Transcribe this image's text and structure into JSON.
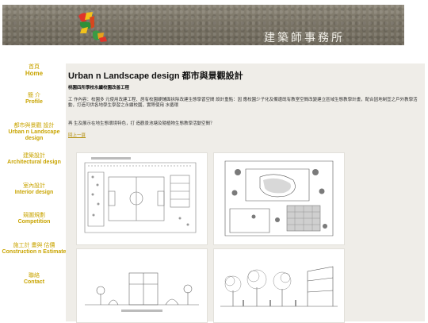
{
  "header": {
    "firm_name": "建築師事務所"
  },
  "nav": {
    "items": [
      {
        "zh": "首頁",
        "en": "Home"
      },
      {
        "zh": "簡 介",
        "en": "Profile"
      },
      {
        "zh": "都市與景觀 設計",
        "en": "Urban n Landscape design"
      },
      {
        "zh": "建築設計",
        "en": "Architectural design"
      },
      {
        "zh": "室內設計",
        "en": "Interior design"
      },
      {
        "zh": "競圖規劃",
        "en": "Competition"
      },
      {
        "zh": "施工計 畫與 估價",
        "en": "Construction n Estimate"
      },
      {
        "zh": "聯絡",
        "en": "Contact"
      }
    ]
  },
  "main": {
    "title": "Urban n Landscape design  都市與景觀設計",
    "subtitle": "桃園四所學校永續校園改善工程",
    "paragraph1": "工 作內容：校園多 元使用改建工程、居有校園硬鋪面拆除改建生態學習空間 設計重點：因 應校園少子化及備邊既有教室空間改變建立區域生態教學計畫，配合因地制宜之戶外教學活動，打造可供各地學生學習之永續校園，實際使用 水循環",
    "paragraph2": "再 生及展示在地生態環境特色，打 造觀景池塘及隨植物生態教學活動空間？",
    "back_link": "回上一頁"
  },
  "colors": {
    "nav_text": "#c9a400",
    "panel_bg": "#efede8",
    "banner_bg": "#7a7466",
    "link": "#b08a00"
  }
}
